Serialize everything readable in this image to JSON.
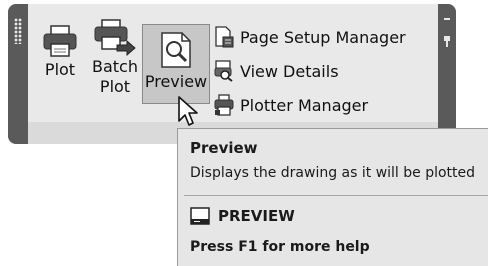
{
  "panel": {
    "buttons": [
      {
        "label_line1": "Plot",
        "icon": "printer-icon"
      },
      {
        "label_line1": "Batch",
        "label_line2": "Plot",
        "icon": "batch-plot-icon"
      },
      {
        "label_line1": "Preview",
        "icon": "preview-icon",
        "state": "hovered"
      }
    ],
    "small_items": [
      {
        "label": "Page Setup Manager",
        "icon": "page-setup-icon"
      },
      {
        "label": "View Details",
        "icon": "view-details-icon"
      },
      {
        "label": "Plotter Manager",
        "icon": "plotter-manager-icon"
      }
    ]
  },
  "tooltip": {
    "title": "Preview",
    "description": "Displays the drawing as it will be plotted",
    "command": "PREVIEW",
    "help": "Press F1 for more help"
  },
  "colors": {
    "panel_bg": "#e9e9e9",
    "frame": "#5a5a5a",
    "hover_bg": "#c7c7c7",
    "tooltip_bg": "#e6e6e6"
  }
}
